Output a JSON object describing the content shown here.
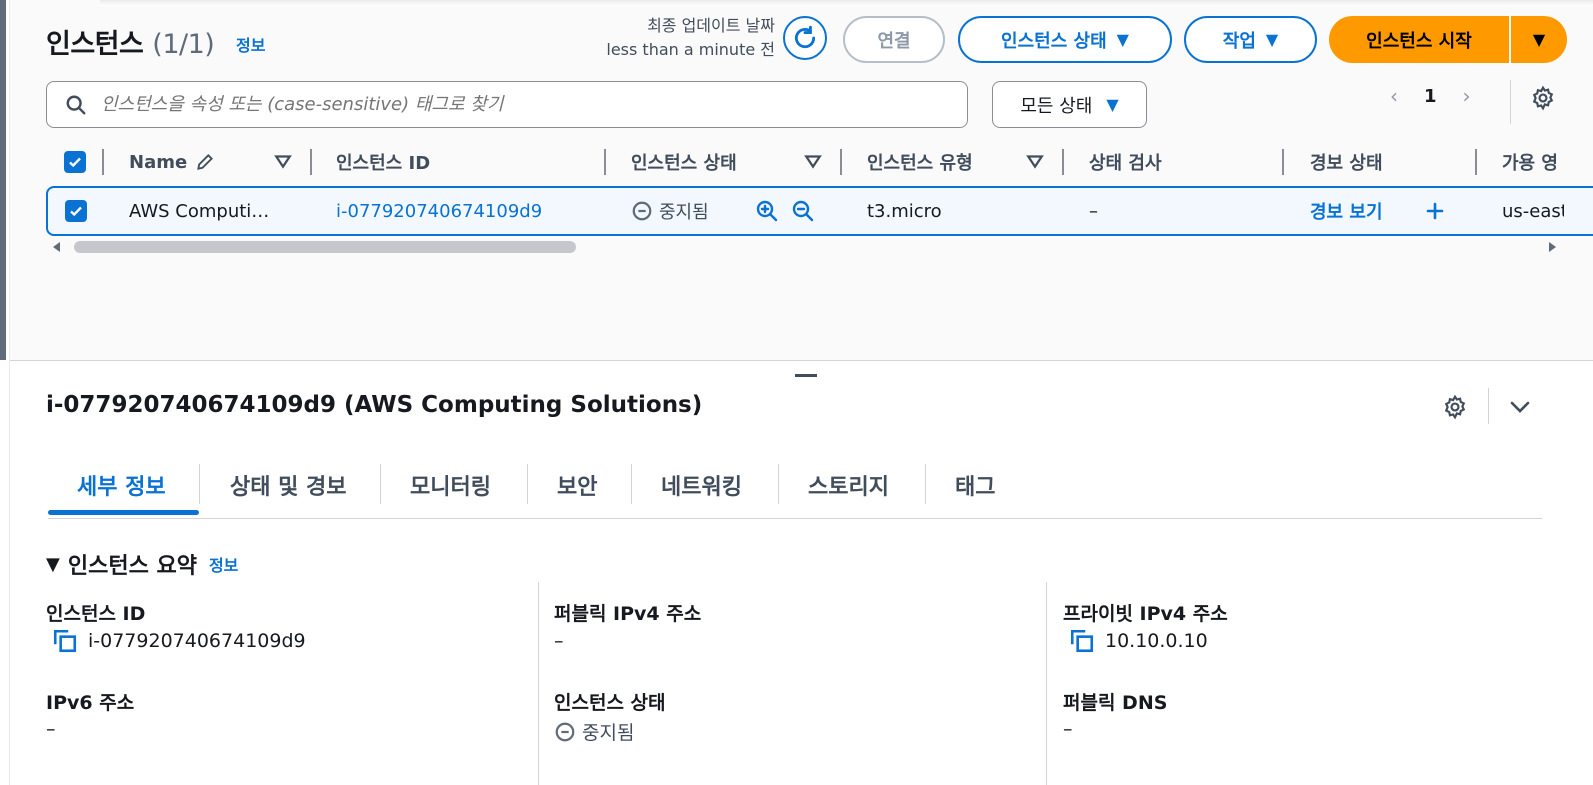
{
  "header": {
    "title": "인스턴스",
    "count": "(1/1)",
    "info": "정보",
    "last_updated_label": "최종 업데이트 날짜",
    "last_updated_value": "less than a minute 전"
  },
  "buttons": {
    "connect": "연결",
    "instance_state": "인스턴스 상태",
    "actions": "작업",
    "launch": "인스턴스 시작"
  },
  "filter": {
    "search_placeholder": "인스턴스을 속성 또는 (case-sensitive) 태그로 찾기",
    "state_select": "모든 상태"
  },
  "pagination": {
    "current_page": "1"
  },
  "table": {
    "columns": [
      "Name",
      "인스턴스 ID",
      "인스턴스 상태",
      "인스턴스 유형",
      "상태 검사",
      "경보 상태",
      "가용 영"
    ],
    "rows": [
      {
        "name": "AWS Computi…",
        "instance_id": "i-077920740674109d9",
        "state": "중지됨",
        "type": "t3.micro",
        "status_check": "–",
        "alarm": "경보 보기",
        "az": "us-east"
      }
    ]
  },
  "details": {
    "title": "i-077920740674109d9 (AWS Computing Solutions)",
    "tabs": [
      "세부 정보",
      "상태 및 경보",
      "모니터링",
      "보안",
      "네트워킹",
      "스토리지",
      "태그"
    ],
    "active_tab": 0,
    "summary_title": "인스턴스 요약",
    "summary_info": "정보",
    "fields": {
      "instance_id_label": "인스턴스 ID",
      "instance_id_value": "i-077920740674109d9",
      "public_ipv4_label": "퍼블릭 IPv4 주소",
      "public_ipv4_value": "–",
      "private_ipv4_label": "프라이빗 IPv4 주소",
      "private_ipv4_value": "10.10.0.10",
      "ipv6_label": "IPv6 주소",
      "ipv6_value": "–",
      "instance_state_label": "인스턴스 상태",
      "instance_state_value": "중지됨",
      "public_dns_label": "퍼블릭 DNS",
      "public_dns_value": "–"
    }
  },
  "colors": {
    "accent": "#0972d3",
    "primary_button": "#ff9900",
    "selected_row_bg": "#f2f8fd"
  },
  "icons": [
    "refresh-icon",
    "caret-down-icon",
    "search-icon",
    "chevron-left-icon",
    "chevron-right-icon",
    "gear-icon",
    "pencil-icon",
    "sort-icon",
    "stopped-icon",
    "zoom-in-icon",
    "zoom-out-icon",
    "plus-icon",
    "copy-icon",
    "chevron-down-icon"
  ]
}
